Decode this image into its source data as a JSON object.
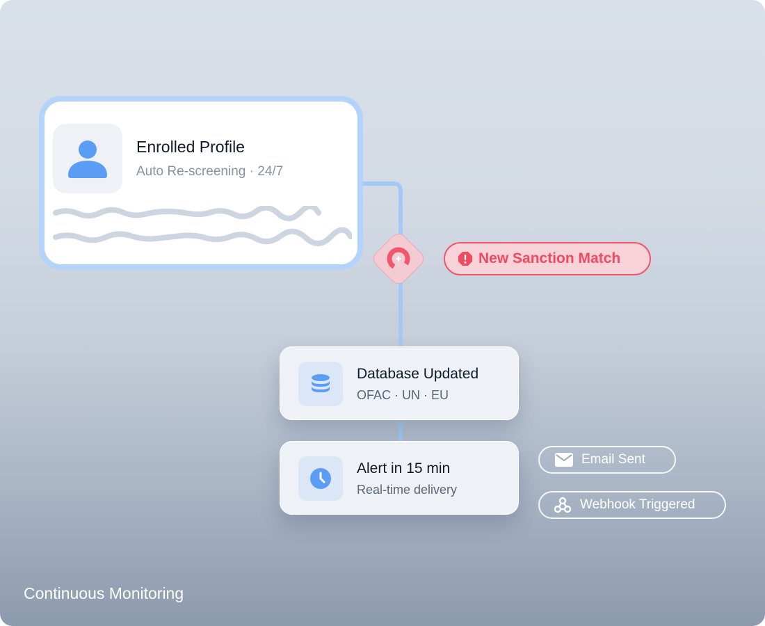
{
  "profile": {
    "title": "Enrolled Profile",
    "subtitle": "Auto Re-screening · 24/7",
    "icon": "user-icon"
  },
  "match_alert": {
    "label": "New Sanction Match",
    "icon": "alert-octagon-icon",
    "color": "#ef4a5f"
  },
  "steps": [
    {
      "title": "Database Updated",
      "subtitle": "OFAC · UN · EU",
      "icon": "database-icon"
    },
    {
      "title": "Alert in 15 min",
      "subtitle": "Real-time delivery",
      "icon": "clock-icon"
    }
  ],
  "channels": [
    {
      "label": "Email Sent",
      "icon": "mail-icon"
    },
    {
      "label": "Webhook Triggered",
      "icon": "webhook-icon"
    }
  ],
  "caption": "Continuous Monitoring",
  "colors": {
    "accent": "#5b9df5",
    "connector": "#9fc6f6",
    "alert": "#ef4a5f"
  }
}
